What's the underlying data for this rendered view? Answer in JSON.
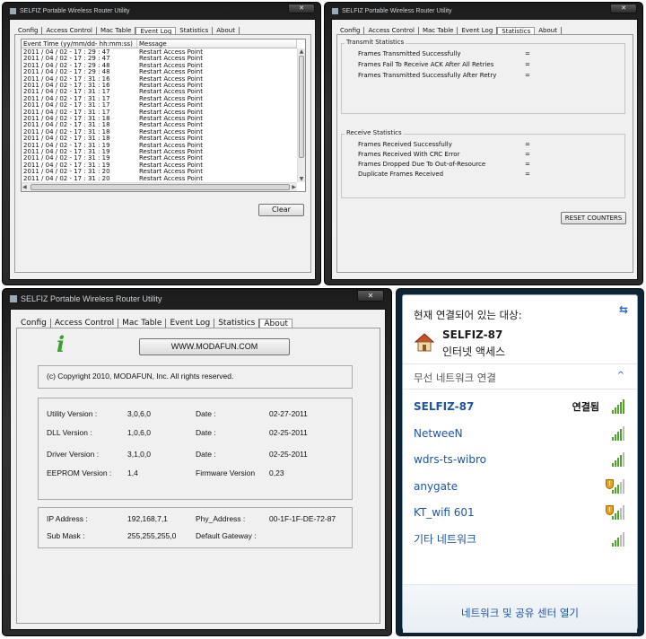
{
  "app_title": "SELFIZ Portable Wireless Router Utility",
  "tabs": [
    "Config",
    "Access Control",
    "Mac Table",
    "Event Log",
    "Statistics",
    "About"
  ],
  "eventlog": {
    "col_time": "Event Time (yy/mm/dd- hh:mm:ss)",
    "col_msg": "Message",
    "rows": [
      [
        "2011 / 04 / 02 - 17 : 29 : 47",
        "Restart Access Point"
      ],
      [
        "2011 / 04 / 02 - 17 : 29 : 47",
        "Restart Access Point"
      ],
      [
        "2011 / 04 / 02 - 17 : 29 : 48",
        "Restart Access Point"
      ],
      [
        "2011 / 04 / 02 - 17 : 29 : 48",
        "Restart Access Point"
      ],
      [
        "2011 / 04 / 02 - 17 : 31 : 16",
        "Restart Access Point"
      ],
      [
        "2011 / 04 / 02 - 17 : 31 : 16",
        "Restart Access Point"
      ],
      [
        "2011 / 04 / 02 - 17 : 31 : 17",
        "Restart Access Point"
      ],
      [
        "2011 / 04 / 02 - 17 : 31 : 17",
        "Restart Access Point"
      ],
      [
        "2011 / 04 / 02 - 17 : 31 : 17",
        "Restart Access Point"
      ],
      [
        "2011 / 04 / 02 - 17 : 31 : 17",
        "Restart Access Point"
      ],
      [
        "2011 / 04 / 02 - 17 : 31 : 18",
        "Restart Access Point"
      ],
      [
        "2011 / 04 / 02 - 17 : 31 : 18",
        "Restart Access Point"
      ],
      [
        "2011 / 04 / 02 - 17 : 31 : 18",
        "Restart Access Point"
      ],
      [
        "2011 / 04 / 02 - 17 : 31 : 18",
        "Restart Access Point"
      ],
      [
        "2011 / 04 / 02 - 17 : 31 : 19",
        "Restart Access Point"
      ],
      [
        "2011 / 04 / 02 - 17 : 31 : 19",
        "Restart Access Point"
      ],
      [
        "2011 / 04 / 02 - 17 : 31 : 19",
        "Restart Access Point"
      ],
      [
        "2011 / 04 / 02 - 17 : 31 : 19",
        "Restart Access Point"
      ],
      [
        "2011 / 04 / 02 - 17 : 31 : 20",
        "Restart Access Point"
      ],
      [
        "2011 / 04 / 02 - 17 : 31 : 20",
        "Restart Access Point"
      ],
      [
        "2011 / 04 / 02 - 17 : 31 : 20",
        "Restart Access Point"
      ]
    ],
    "clear_label": "Clear"
  },
  "statistics": {
    "transmit_title": "Transmit Statistics",
    "transmit": [
      "Frames Transmitted Successfully",
      "Frames Fail To Receive ACK After All Retries",
      "Frames Transmitted Successfully After Retry"
    ],
    "receive_title": "Receive Statistics",
    "receive": [
      "Frames Received Successfully",
      "Frames Received With CRC Error",
      "Frames Dropped Due To Out-of-Resource",
      "Duplicate Frames Received"
    ],
    "eq": "=",
    "reset_label": "RESET COUNTERS"
  },
  "about": {
    "website": "WWW.MODAFUN.COM",
    "copyright": "(c) Copyright 2010, MODAFUN, Inc.  All rights reserved.",
    "utility_label": "Utility Version :",
    "utility_value": "3,0,6,0",
    "dll_label": "DLL Version :",
    "dll_value": "1,0,6,0",
    "driver_label": "Driver Version :",
    "driver_value": "3,1,0,0",
    "eeprom_label": "EEPROM Version :",
    "eeprom_value": "1,4",
    "date_label": "Date :",
    "date1": "02-27-2011",
    "date2": "02-25-2011",
    "date3": "02-25-2011",
    "firmware_label": "Firmware Version",
    "firmware_value": "0,23",
    "ip_label": "IP Address :",
    "ip_value": "192,168,7,1",
    "mask_label": "Sub Mask :",
    "mask_value": "255,255,255,0",
    "phy_label": "Phy_Address :",
    "phy_value": "00-1F-1F-DE-72-87",
    "gateway_label": "Default Gateway :"
  },
  "wifi": {
    "header": "현재 연결되어 있는 대상:",
    "current_name": "SELFIZ-87",
    "current_status": "인터넷 액세스",
    "section": "무선 네트워크 연결",
    "connected_label": "연결됨",
    "networks": [
      {
        "name": "SELFIZ-87",
        "bars": 5,
        "secured": false
      },
      {
        "name": "NetweeN",
        "bars": 4,
        "secured": false
      },
      {
        "name": "wdrs-ts-wibro",
        "bars": 4,
        "secured": false
      },
      {
        "name": "anygate",
        "bars": 3,
        "secured": true
      },
      {
        "name": "KT_wifi 601",
        "bars": 3,
        "secured": true
      },
      {
        "name": "기타 네트워크",
        "bars": 3,
        "secured": false
      }
    ],
    "footer": "네트워크 및 공유 센터 열기",
    "colors": {
      "link": "#1d55a8",
      "signal": "#4fa52a",
      "shield": "#e4a01a"
    }
  }
}
